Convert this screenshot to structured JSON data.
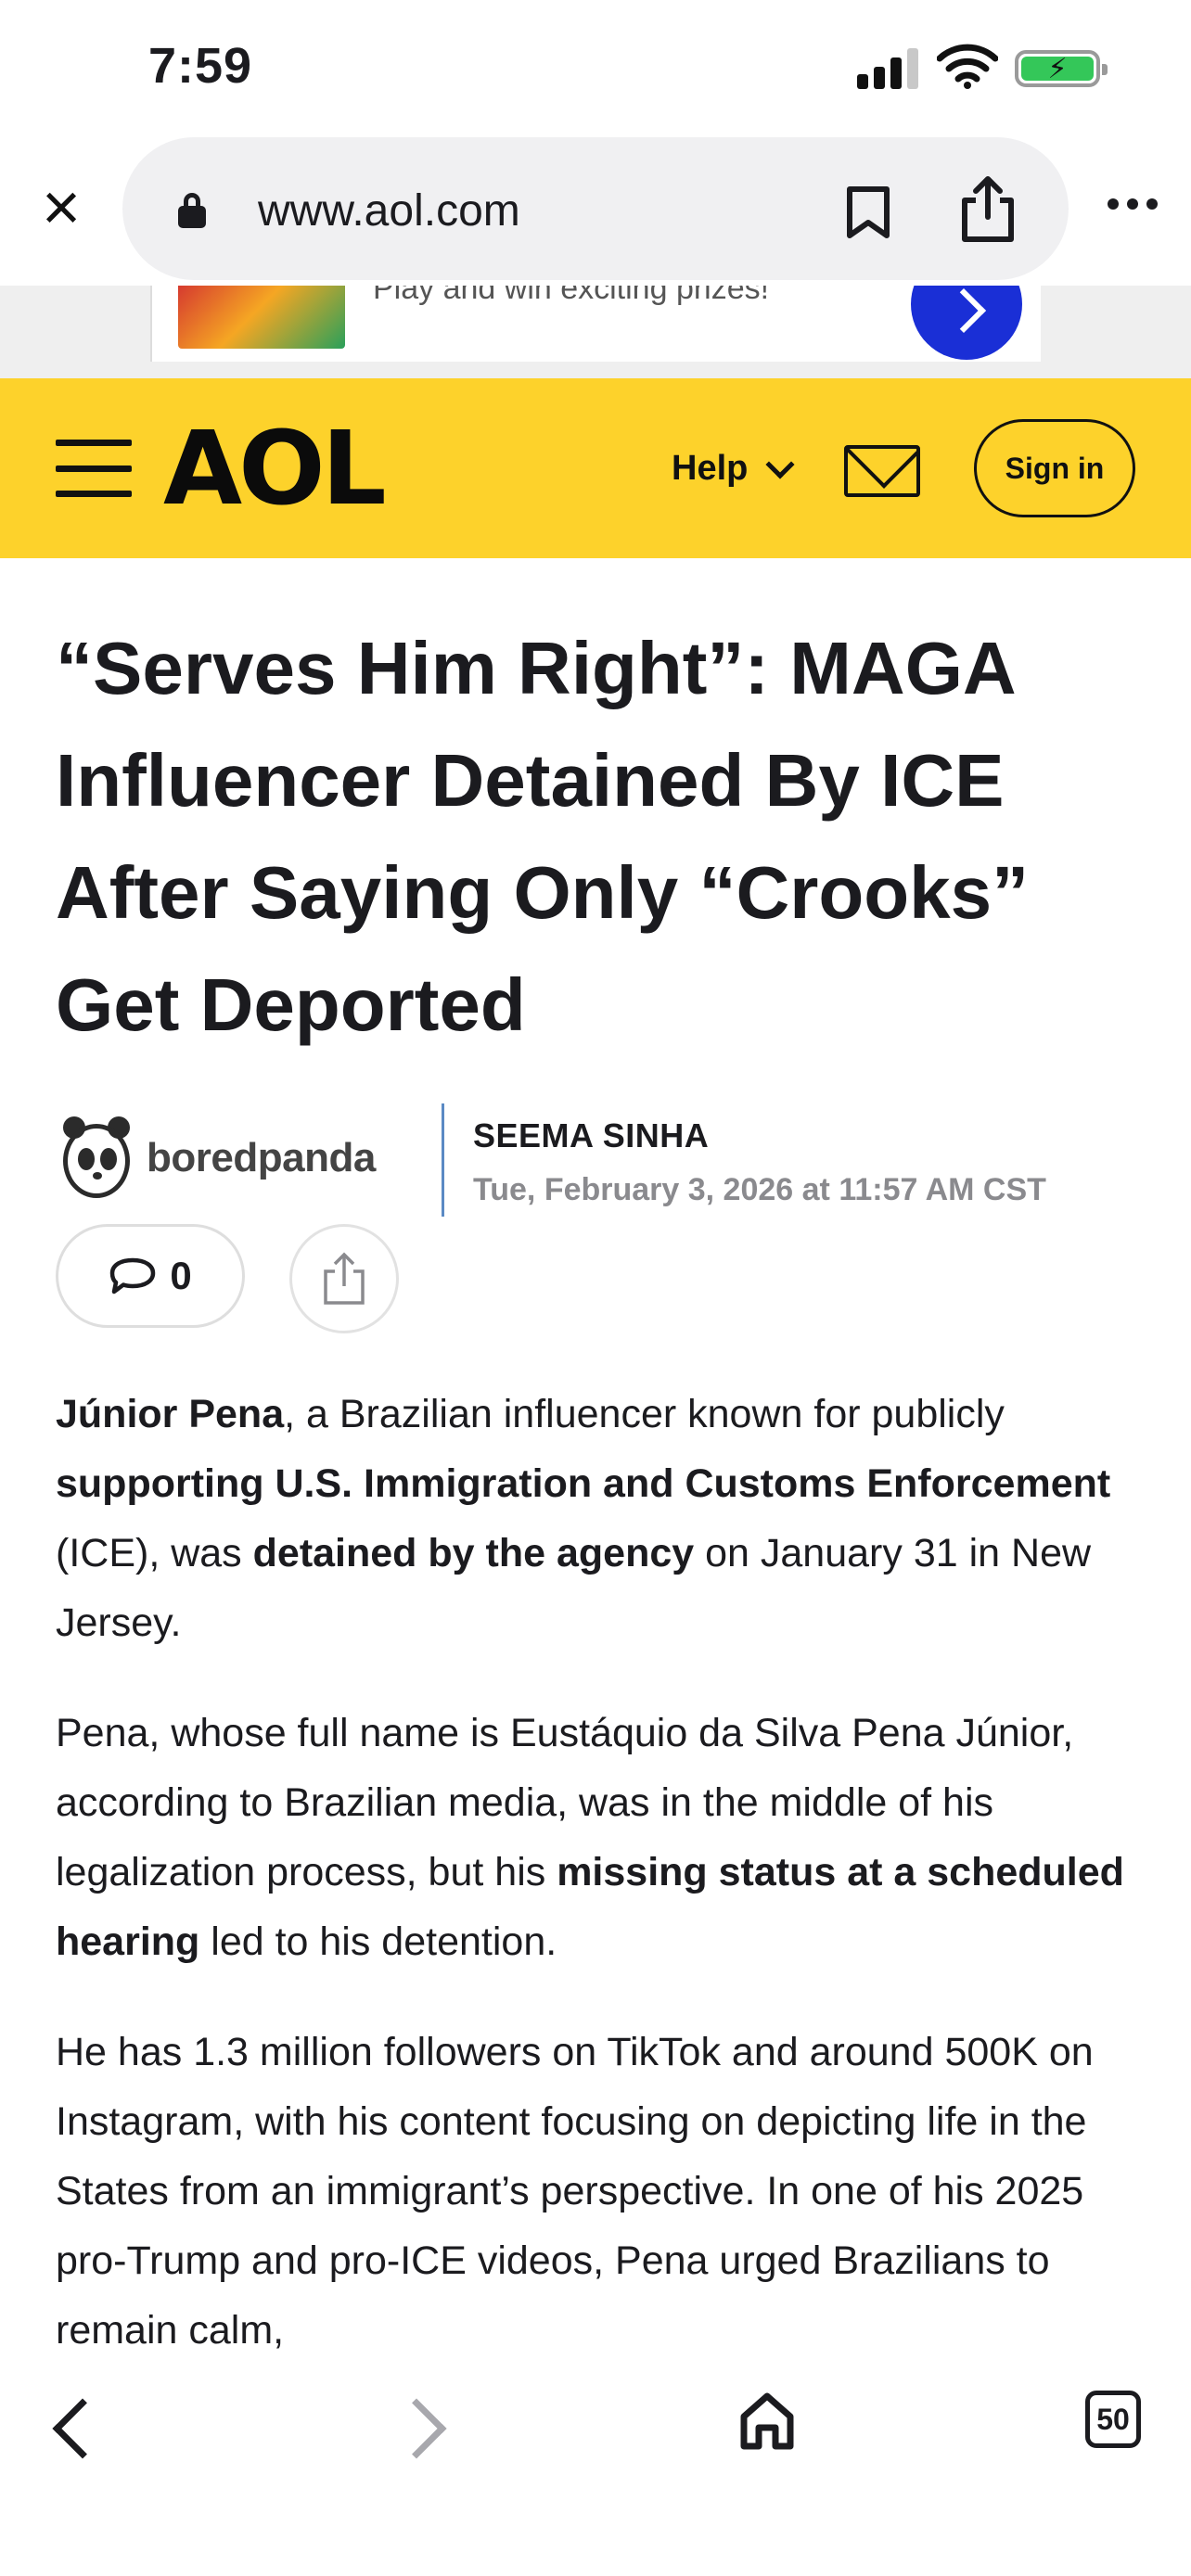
{
  "status_bar": {
    "time": "7:59"
  },
  "browser": {
    "url": "www.aol.com"
  },
  "ad": {
    "text": "Play and win exciting prizes!"
  },
  "site_header": {
    "logo": "AOL",
    "help_label": "Help",
    "sign_in_label": "Sign in",
    "accent_color": "#fdd22b"
  },
  "article": {
    "headline": "“Serves Him Right”: MAGA Influencer Detained By ICE After Saying Only “Crooks” Get Deported",
    "source": "boredpanda",
    "author": "SEEMA SINHA",
    "published": "Tue, February 3, 2026 at 11:57 AM CST",
    "comment_count": "0",
    "paragraphs": [
      [
        {
          "text": "Júnior Pena",
          "bold": true
        },
        {
          "text": ", a Brazilian influencer known for publicly ",
          "bold": false
        },
        {
          "text": "supporting U.S. Immigration and Customs Enforcement",
          "bold": true
        },
        {
          "text": " (ICE), was ",
          "bold": false
        },
        {
          "text": "detained by the agency",
          "bold": true
        },
        {
          "text": " on January 31 in New Jersey.",
          "bold": false
        }
      ],
      [
        {
          "text": "Pena, whose full name is Eustáquio da Silva Pena Júnior, according to Brazilian media, was in the middle of his legalization process, but his ",
          "bold": false
        },
        {
          "text": "missing status at a scheduled hearing",
          "bold": true
        },
        {
          "text": " led to his detention.",
          "bold": false
        }
      ],
      [
        {
          "text": "He has 1.3 million followers on TikTok and around 500K on Instagram, with his content focusing on depicting life in the States from an immigrant’s perspective. In one of his 2025 pro-Trump and pro-ICE videos, Pena urged Brazilians to remain calm,",
          "bold": false
        }
      ]
    ]
  },
  "bottom_nav": {
    "tab_count": "50"
  }
}
